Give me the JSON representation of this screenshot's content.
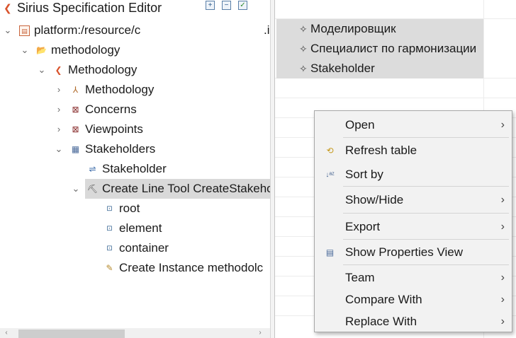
{
  "editor": {
    "title": "Sirius Specification Editor",
    "title_icon": "sirius-editor-icon",
    "toolbar": [
      {
        "name": "expand-all-icon",
        "glyph": "⊞"
      },
      {
        "name": "collapse-all-icon",
        "glyph": "⊟"
      },
      {
        "name": "validate-icon",
        "glyph": "✓"
      }
    ]
  },
  "tree": {
    "platform": {
      "label": "platform:/resource/c",
      "suffix": ".i"
    },
    "methodology_folder": {
      "label": "methodology"
    },
    "methodology_root": {
      "label": "Methodology"
    },
    "methodology_child": {
      "label": "Methodology"
    },
    "concerns": {
      "label": "Concerns"
    },
    "viewpoints": {
      "label": "Viewpoints"
    },
    "stakeholders": {
      "label": "Stakeholders"
    },
    "stakeholder": {
      "label": "Stakeholder"
    },
    "create_line_tool": {
      "label": "Create Line Tool CreateStakeho"
    },
    "root_var": {
      "label": "root"
    },
    "element_var": {
      "label": "element"
    },
    "container_var": {
      "label": "container"
    },
    "create_instance": {
      "label": "Create Instance methodolc"
    }
  },
  "table": {
    "rows": [
      {
        "icon": "row-element-icon",
        "label": "Моделировщик"
      },
      {
        "icon": "row-element-icon",
        "label": "Специалист по гармонизации"
      },
      {
        "icon": "row-element-icon",
        "label": "Stakeholder"
      }
    ]
  },
  "context_menu": {
    "items": [
      {
        "label": "Open",
        "icon": null,
        "submenu": true
      },
      {
        "label": "Refresh table",
        "icon": "refresh-icon",
        "submenu": false
      },
      {
        "label": "Sort by",
        "icon": "sort-az-icon",
        "submenu": false
      },
      {
        "label": "Show/Hide",
        "icon": null,
        "submenu": true
      },
      {
        "label": "Export",
        "icon": null,
        "submenu": true
      },
      {
        "label": "Show Properties View",
        "icon": "properties-view-icon",
        "submenu": false
      },
      {
        "label": "Team",
        "icon": null,
        "submenu": true
      },
      {
        "label": "Compare With",
        "icon": null,
        "submenu": true
      },
      {
        "label": "Replace With",
        "icon": null,
        "submenu": true
      }
    ]
  },
  "colors": {
    "selection_bg": "#d9d9d9",
    "table_row_bg": "#dcdcdc",
    "menu_bg": "#f2f2f2",
    "sirius_accent": "#d9532c"
  }
}
